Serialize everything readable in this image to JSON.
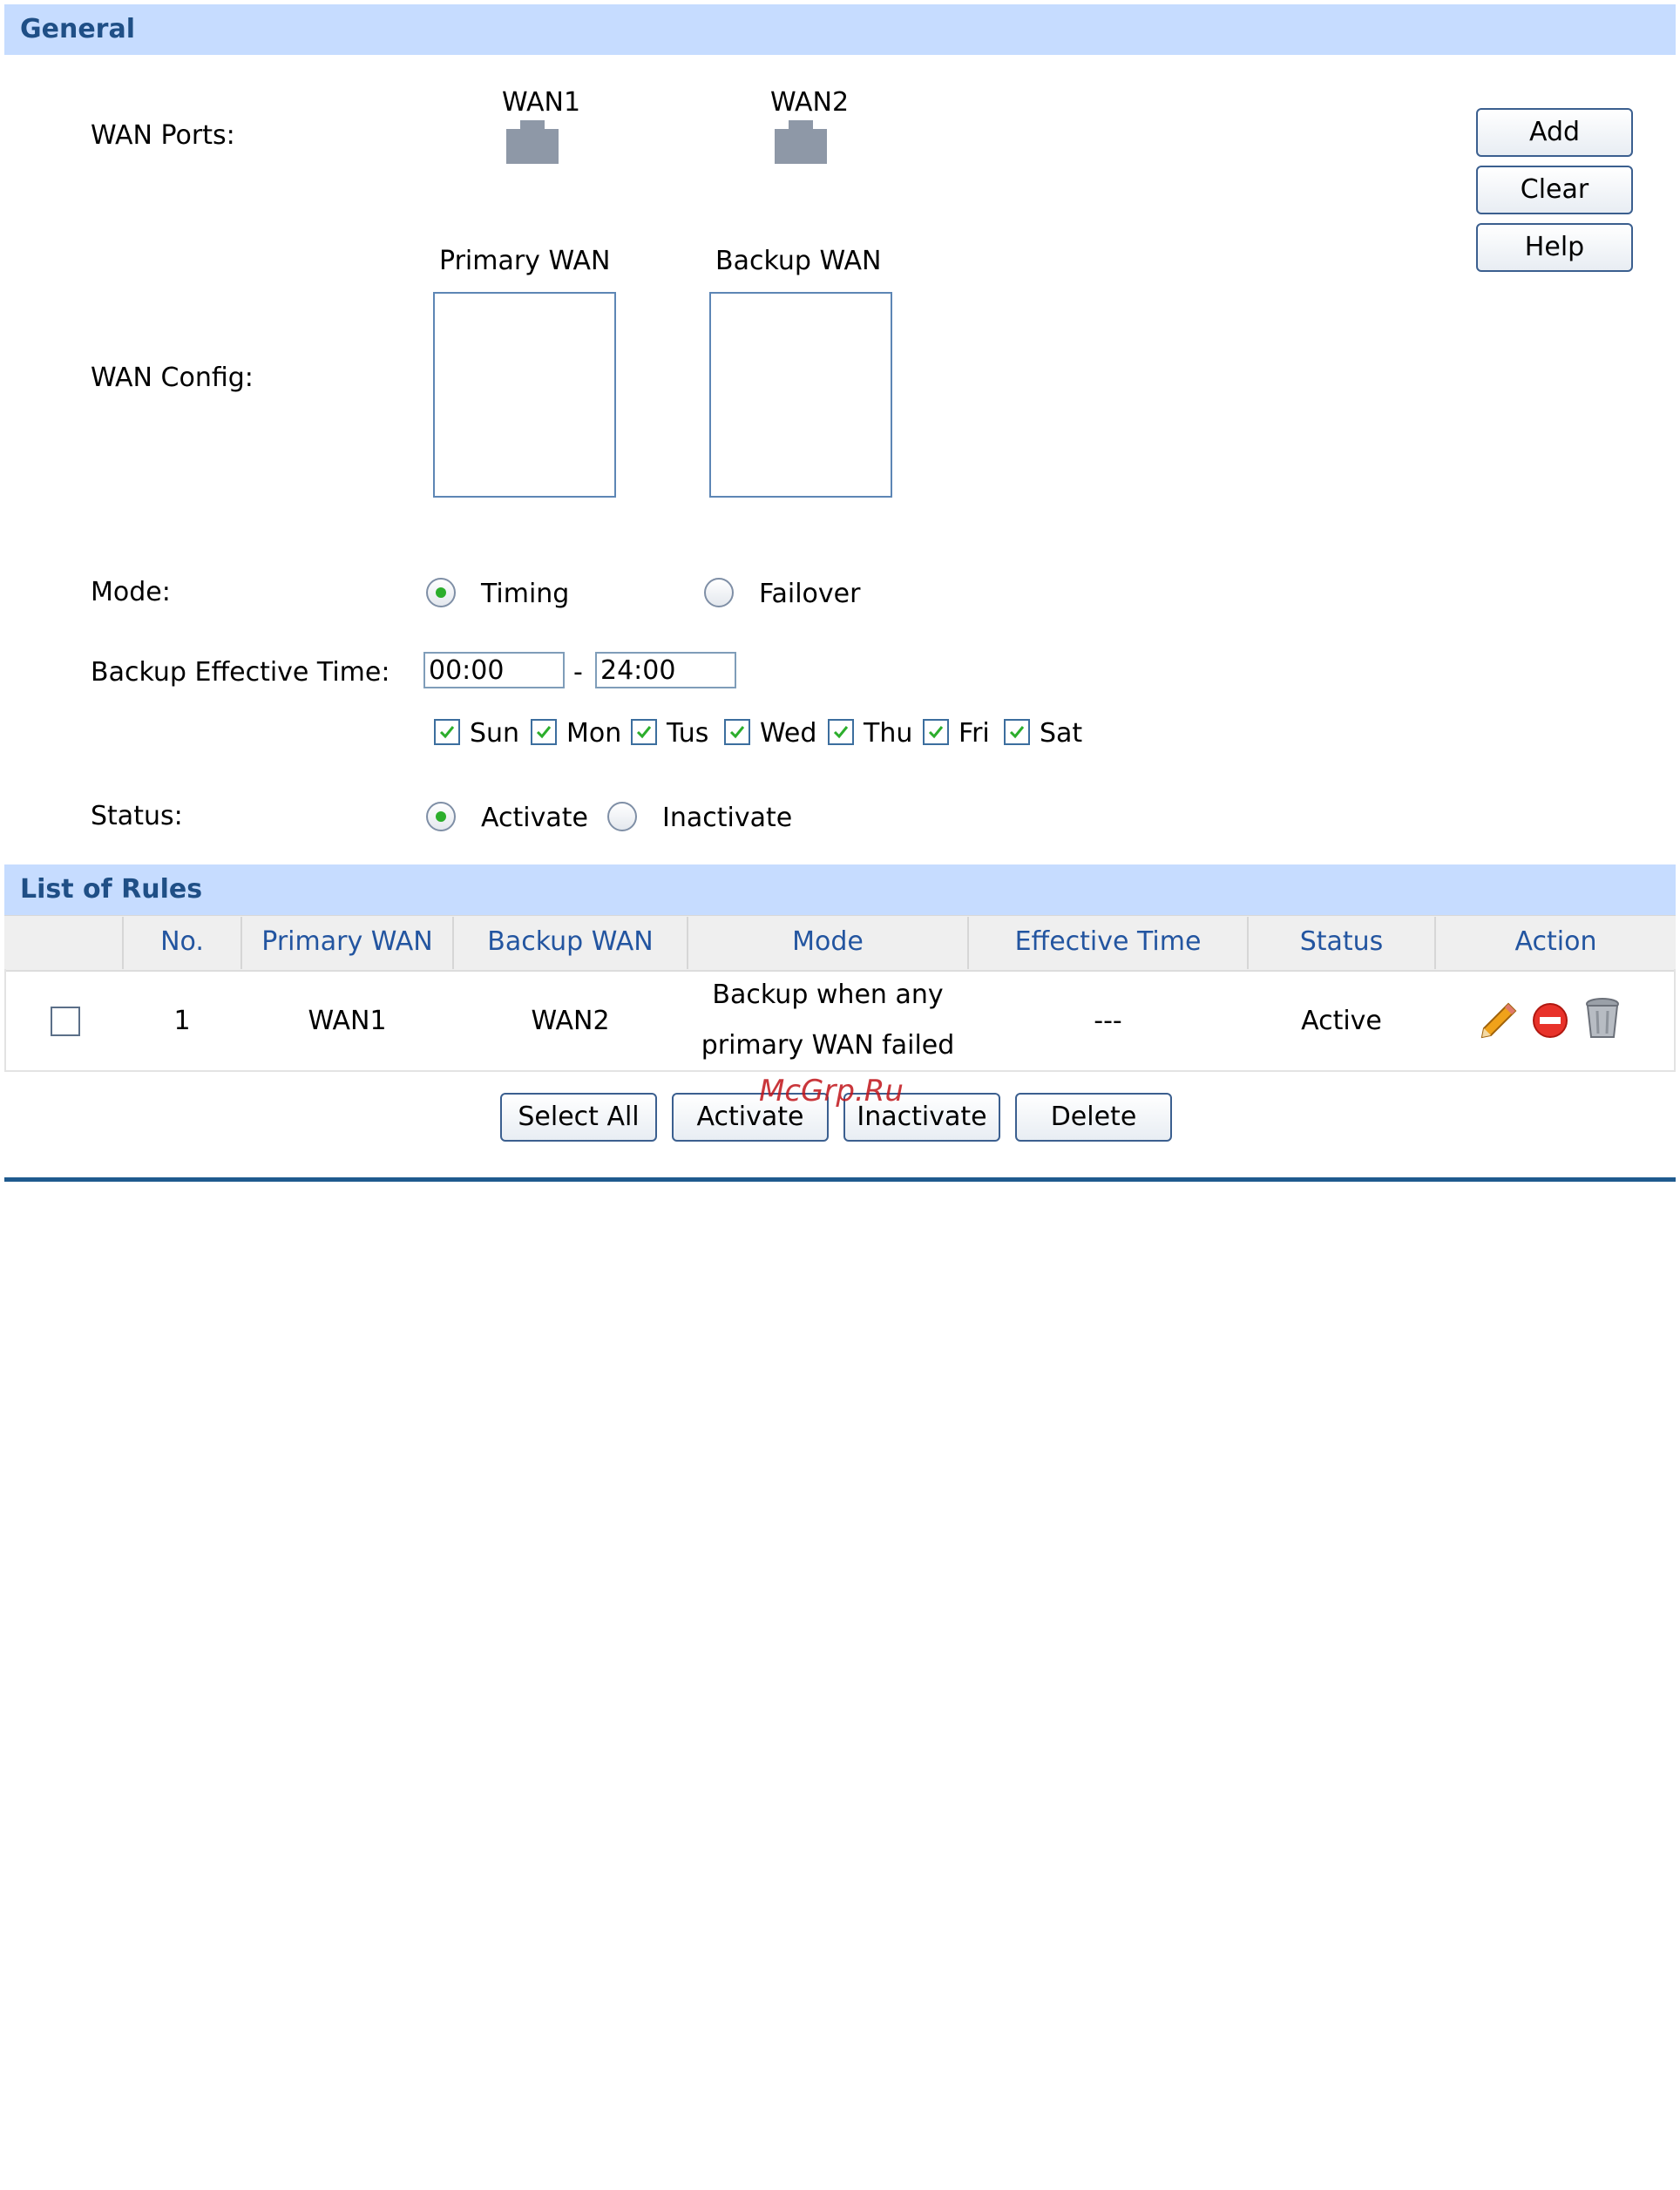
{
  "general": {
    "title": "General",
    "wan_ports_label": "WAN Ports:",
    "ports": [
      "WAN1",
      "WAN2"
    ],
    "wan_config_label": "WAN Config:",
    "primary_wan_label": "Primary WAN",
    "backup_wan_label": "Backup WAN",
    "mode_label": "Mode:",
    "mode_options": [
      "Timing",
      "Failover"
    ],
    "mode_selected": "Timing",
    "backup_time_label": "Backup Effective Time:",
    "time_start": "00:00",
    "time_separator": "-",
    "time_end": "24:00",
    "days": [
      "Sun",
      "Mon",
      "Tus",
      "Wed",
      "Thu",
      "Fri",
      "Sat"
    ],
    "status_label": "Status:",
    "status_options": [
      "Activate",
      "Inactivate"
    ],
    "status_selected": "Activate",
    "buttons": {
      "add": "Add",
      "clear": "Clear",
      "help": "Help"
    }
  },
  "rules": {
    "title": "List of Rules",
    "columns": [
      "No.",
      "Primary WAN",
      "Backup WAN",
      "Mode",
      "Effective Time",
      "Status",
      "Action"
    ],
    "rows": [
      {
        "no": "1",
        "primary": "WAN1",
        "backup": "WAN2",
        "mode_line1": "Backup when any",
        "mode_line2": "primary WAN failed",
        "effective_time": "---",
        "status": "Active"
      }
    ],
    "buttons": {
      "select_all": "Select All",
      "activate": "Activate",
      "inactivate": "Inactivate",
      "delete": "Delete"
    }
  },
  "watermark": "McGrp.Ru",
  "colors": {
    "section_bar": "#c6dcff",
    "header_text": "#2355a0",
    "divider": "#1f5a8e",
    "check": "#2cae2c"
  }
}
